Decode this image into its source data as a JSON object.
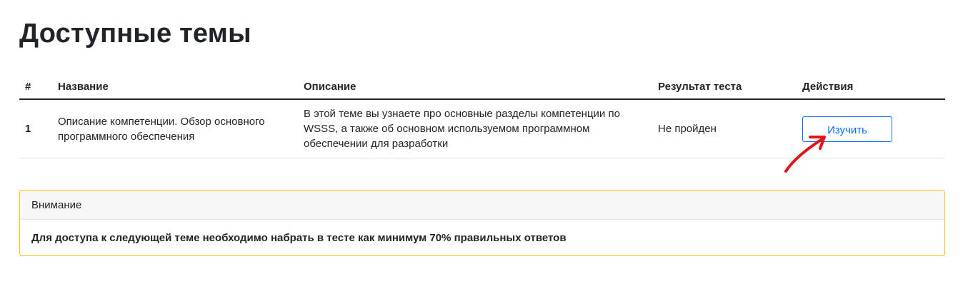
{
  "page": {
    "title": "Доступные темы"
  },
  "table": {
    "headers": {
      "num": "#",
      "name": "Название",
      "description": "Описание",
      "result": "Результат теста",
      "actions": "Действия"
    },
    "rows": [
      {
        "num": "1",
        "name": "Описание компетенции. Обзор основного программного обеспечения",
        "description": "В этой теме вы узнаете про основные разделы компетенции по WSSS, а также об основном используемом программном обеспечении для разработки",
        "result": "Не пройден",
        "action_label": "Изучить"
      }
    ]
  },
  "alert": {
    "header": "Внимание",
    "body": "Для доступа к следующей теме необходимо набрать в тесте как минимум 70% правильных ответов"
  },
  "colors": {
    "accent": "#0d6efd",
    "warning_border": "#ffc107",
    "annotation": "#e0161b"
  },
  "annotation": {
    "icon": "red-arrow-icon"
  }
}
